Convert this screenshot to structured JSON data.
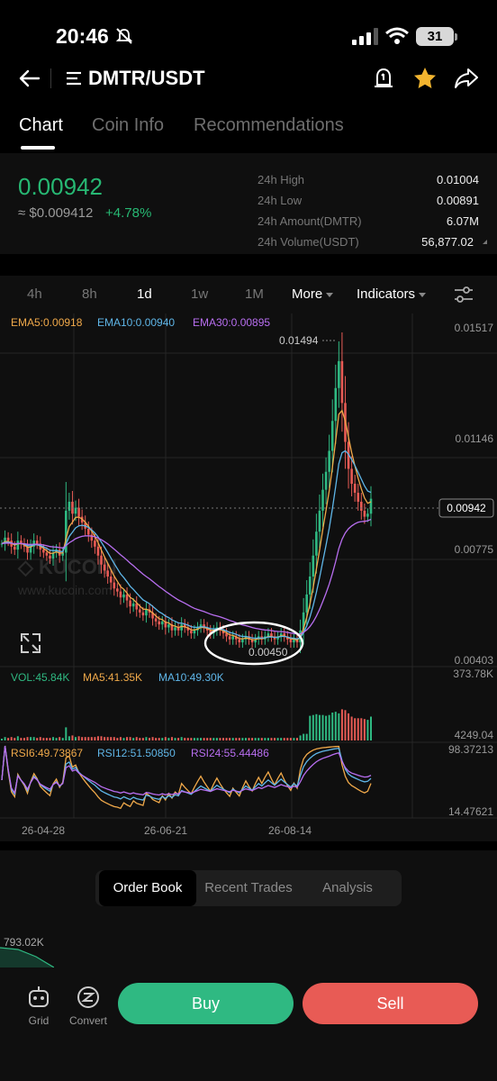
{
  "status_bar": {
    "time": "20:46",
    "battery": "31"
  },
  "header": {
    "pair": "DMTR/USDT"
  },
  "tabs": [
    {
      "label": "Chart",
      "active": true
    },
    {
      "label": "Coin Info",
      "active": false
    },
    {
      "label": "Recommendations",
      "active": false
    }
  ],
  "price": {
    "last": "0.00942",
    "fiat": "≈ $0.009412",
    "change": "+4.78%",
    "up_color": "#27b873"
  },
  "stats": [
    {
      "label": "24h High",
      "value": "0.01004"
    },
    {
      "label": "24h Low",
      "value": "0.00891"
    },
    {
      "label": "24h Amount(DMTR)",
      "value": "6.07M"
    },
    {
      "label": "24h Volume(USDT)",
      "value": "56,877.02"
    }
  ],
  "intervals": {
    "items": [
      "4h",
      "8h",
      "1d",
      "1w",
      "1M"
    ],
    "active": "1d",
    "more_label": "More",
    "indicators_label": "Indicators"
  },
  "chart_data": {
    "type": "candlestick",
    "legend_ema": [
      "EMA5:0.00918",
      "EMA10:0.00940",
      "EMA30:0.00895"
    ],
    "legend_vol": [
      "VOL:45.84K",
      "MA5:41.35K",
      "MA10:49.30K"
    ],
    "legend_rsi": [
      "RSI6:49.73867",
      "RSI12:51.50850",
      "RSI24:55.44486"
    ],
    "price_axis": [
      "0.01517",
      "0.01146",
      "0.00775",
      "0.00403"
    ],
    "ylim": [
      0.00403,
      0.01517
    ],
    "current_price": "0.00942",
    "marker_high": "0.01494",
    "marker_low": "0.00450",
    "volume_axis": [
      "373.78K",
      "4249.04"
    ],
    "rsi_axis": [
      "98.37213",
      "14.47621"
    ],
    "x_labels": [
      "26-04-28",
      "26-06-21",
      "26-08-14"
    ],
    "watermark_url": "www.kucoin.com",
    "colors": {
      "up": "#2fb982",
      "down": "#e85b55",
      "ema5": "#f0a94a",
      "ema10": "#5fb6e8",
      "ema30": "#b86ef0"
    },
    "close_series": [
      0.0079,
      0.0081,
      0.008,
      0.0078,
      0.0077,
      0.008,
      0.0079,
      0.0078,
      0.0076,
      0.0078,
      0.008,
      0.0079,
      0.0077,
      0.0076,
      0.0075,
      0.0074,
      0.0076,
      0.0077,
      0.0075,
      0.0076,
      0.009,
      0.0093,
      0.0089,
      0.0091,
      0.0088,
      0.0086,
      0.0084,
      0.0082,
      0.008,
      0.0078,
      0.0075,
      0.0072,
      0.007,
      0.0068,
      0.0066,
      0.0064,
      0.0063,
      0.0061,
      0.0062,
      0.006,
      0.0058,
      0.0059,
      0.0057,
      0.0056,
      0.0055,
      0.0057,
      0.0056,
      0.0054,
      0.0053,
      0.0052,
      0.0053,
      0.0051,
      0.0052,
      0.005,
      0.0051,
      0.005,
      0.0052,
      0.0051,
      0.005,
      0.0049,
      0.005,
      0.0051,
      0.0052,
      0.0051,
      0.005,
      0.0049,
      0.005,
      0.0051,
      0.005,
      0.0049,
      0.0048,
      0.0047,
      0.0048,
      0.0047,
      0.0046,
      0.0047,
      0.0048,
      0.0047,
      0.0046,
      0.0047,
      0.0048,
      0.0047,
      0.0048,
      0.0049,
      0.0048,
      0.0047,
      0.0048,
      0.0049,
      0.0048,
      0.0047,
      0.0046,
      0.0047,
      0.0046,
      0.005,
      0.0056,
      0.0062,
      0.0068,
      0.0075,
      0.0083,
      0.009,
      0.0097,
      0.0103,
      0.011,
      0.012,
      0.0131,
      0.014,
      0.0126,
      0.0113,
      0.0104,
      0.0099,
      0.0096,
      0.0093,
      0.009,
      0.0088,
      0.0089,
      0.0094
    ]
  },
  "bottom": {
    "segments": [
      "Order Book",
      "Recent Trades",
      "Analysis"
    ],
    "active_segment": "Order Book",
    "depth_value": "793.02K",
    "nav": [
      {
        "label": "Grid"
      },
      {
        "label": "Convert"
      }
    ],
    "buy_label": "Buy",
    "sell_label": "Sell"
  }
}
